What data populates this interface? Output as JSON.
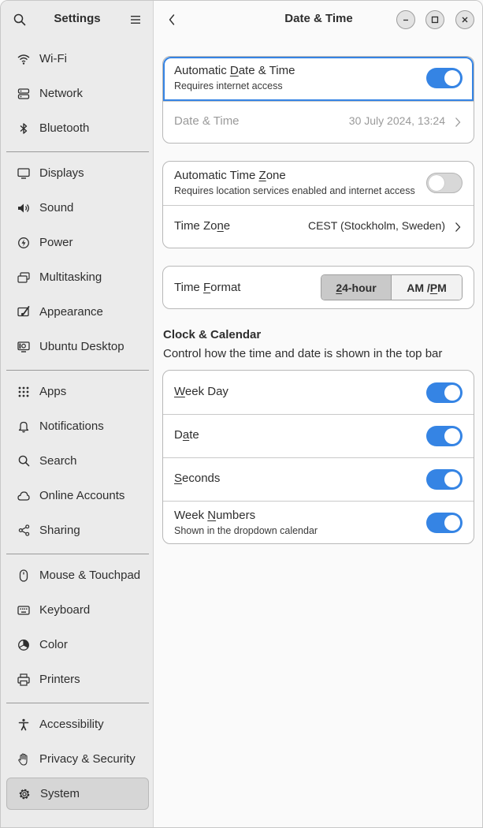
{
  "sidebar": {
    "title": "Settings",
    "items": [
      {
        "label": "Wi-Fi",
        "icon": "wifi-icon"
      },
      {
        "label": "Network",
        "icon": "network-icon"
      },
      {
        "label": "Bluetooth",
        "icon": "bluetooth-icon"
      },
      {
        "label": "Displays",
        "icon": "display-icon"
      },
      {
        "label": "Sound",
        "icon": "speaker-icon"
      },
      {
        "label": "Power",
        "icon": "power-icon"
      },
      {
        "label": "Multitasking",
        "icon": "multitasking-icon"
      },
      {
        "label": "Appearance",
        "icon": "appearance-icon"
      },
      {
        "label": "Ubuntu Desktop",
        "icon": "ubuntu-desktop-icon"
      },
      {
        "label": "Apps",
        "icon": "apps-grid-icon"
      },
      {
        "label": "Notifications",
        "icon": "bell-icon"
      },
      {
        "label": "Search",
        "icon": "search-icon"
      },
      {
        "label": "Online Accounts",
        "icon": "cloud-icon"
      },
      {
        "label": "Sharing",
        "icon": "share-icon"
      },
      {
        "label": "Mouse & Touchpad",
        "icon": "mouse-icon"
      },
      {
        "label": "Keyboard",
        "icon": "keyboard-icon"
      },
      {
        "label": "Color",
        "icon": "color-icon"
      },
      {
        "label": "Printers",
        "icon": "printer-icon"
      },
      {
        "label": "Accessibility",
        "icon": "accessibility-icon"
      },
      {
        "label": "Privacy & Security",
        "icon": "hand-icon"
      },
      {
        "label": "System",
        "icon": "gear-icon"
      }
    ],
    "selected": "System"
  },
  "header": {
    "title": "Date & Time"
  },
  "auto_datetime": {
    "title_pre": "Automatic ",
    "title_u": "D",
    "title_post": "ate & Time",
    "subtitle": "Requires internet access",
    "enabled": true
  },
  "datetime": {
    "title": "Date & Time",
    "value": "30 July 2024, 13:24"
  },
  "auto_timezone": {
    "title_pre": "Automatic Time ",
    "title_u": "Z",
    "title_post": "one",
    "subtitle": "Requires location services enabled and internet access",
    "enabled": false
  },
  "timezone": {
    "title_pre": "Time Zo",
    "title_u": "n",
    "title_post": "e",
    "value": "CEST (Stockholm, Sweden)"
  },
  "time_format": {
    "title_pre": "Time ",
    "title_u": "F",
    "title_post": "ormat",
    "option_24_u": "2",
    "option_24_rest": "4-hour",
    "option_ampm_pre": "AM / ",
    "option_ampm_u": "P",
    "option_ampm_post": "M",
    "selected": "24-hour"
  },
  "clock_calendar": {
    "title": "Clock & Calendar",
    "subtitle": "Control how the time and date is shown in the top bar",
    "week_day": {
      "u": "W",
      "rest": "eek Day",
      "enabled": true
    },
    "date": {
      "pre": "D",
      "u": "a",
      "post": "te",
      "enabled": true
    },
    "seconds": {
      "u": "S",
      "rest": "econds",
      "enabled": true
    },
    "week_numbers": {
      "pre": "Week ",
      "u": "N",
      "post": "umbers",
      "subtitle": "Shown in the dropdown calendar",
      "enabled": true
    }
  },
  "colors": {
    "accent": "#3584e4",
    "selected_bg": "#d6d6d6"
  }
}
